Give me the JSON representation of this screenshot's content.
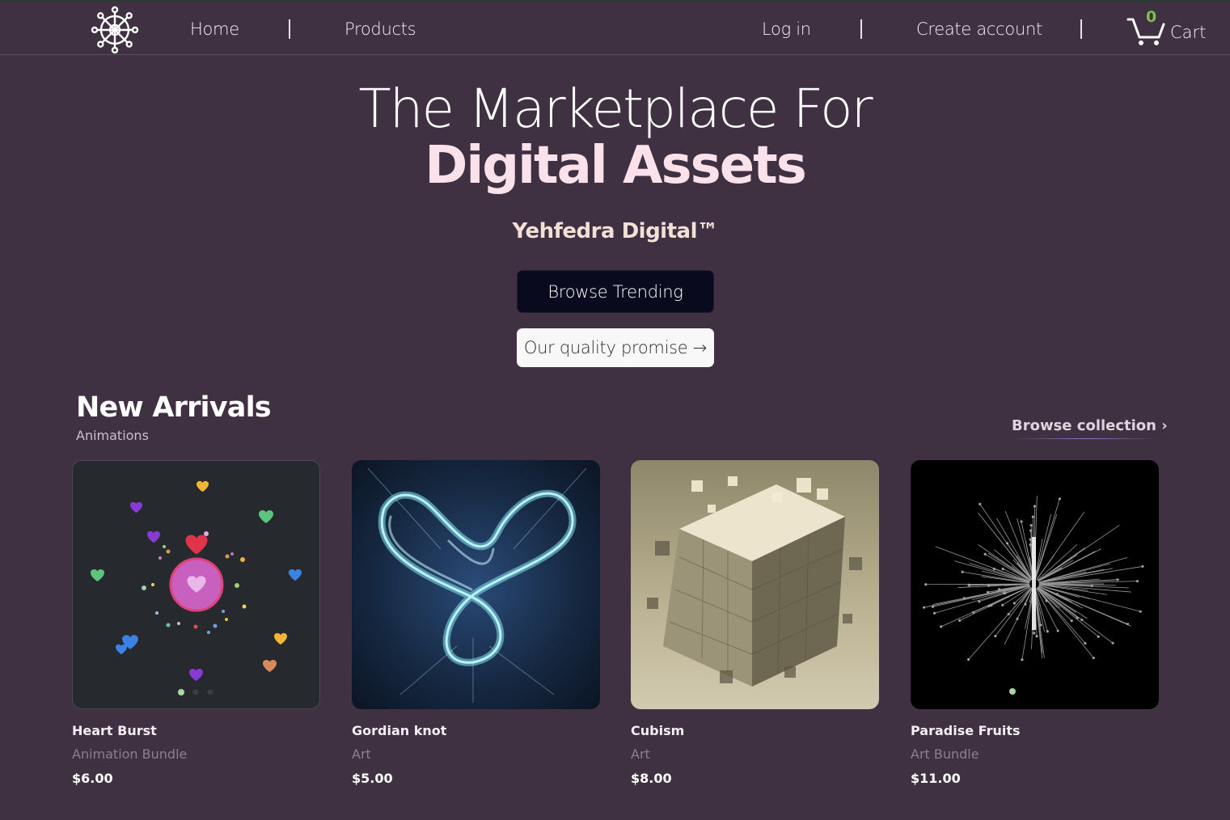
{
  "nav": {
    "home": "Home",
    "products": "Products",
    "login": "Log in",
    "create_account": "Create account",
    "cart_count": "0",
    "cart_label": "Cart"
  },
  "hero": {
    "title_line1": "The Marketplace For",
    "title_line2": "Digital Assets",
    "brand": "Yehfedra Digital™",
    "primary_button": "Browse Trending",
    "secondary_button": "Our quality promise →"
  },
  "section": {
    "title": "New Arrivals",
    "subtitle": "Animations",
    "browse_link": "Browse collection ›"
  },
  "products": [
    {
      "name": "Heart Burst",
      "category": "Animation Bundle",
      "price": "$6.00"
    },
    {
      "name": "Gordian knot",
      "category": "Art",
      "price": "$5.00"
    },
    {
      "name": "Cubism",
      "category": "Art",
      "price": "$8.00"
    },
    {
      "name": "Paradise Fruits",
      "category": "Art Bundle",
      "price": "$11.00"
    }
  ],
  "colors": {
    "background": "#3f3142",
    "accent_pink": "#fbe1ea",
    "cart_count": "#7dbe4a",
    "dark_button": "#090a1d"
  },
  "icons": [
    "ship-wheel-logo-icon",
    "cart-icon",
    "chevron-right-icon"
  ]
}
